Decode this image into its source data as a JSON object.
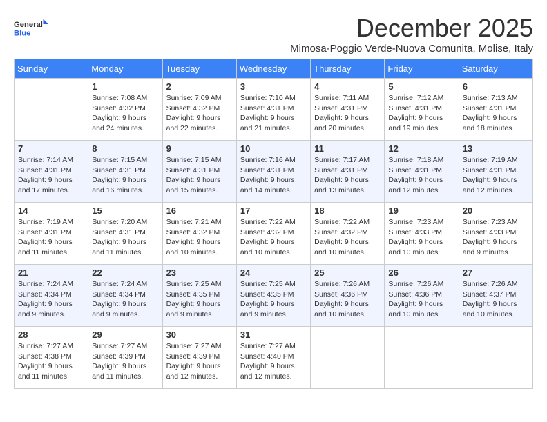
{
  "logo": {
    "general": "General",
    "blue": "Blue"
  },
  "title": "December 2025",
  "subtitle": "Mimosa-Poggio Verde-Nuova Comunita, Molise, Italy",
  "days_of_week": [
    "Sunday",
    "Monday",
    "Tuesday",
    "Wednesday",
    "Thursday",
    "Friday",
    "Saturday"
  ],
  "weeks": [
    [
      {
        "day": "",
        "info": ""
      },
      {
        "day": "1",
        "info": "Sunrise: 7:08 AM\nSunset: 4:32 PM\nDaylight: 9 hours\nand 24 minutes."
      },
      {
        "day": "2",
        "info": "Sunrise: 7:09 AM\nSunset: 4:32 PM\nDaylight: 9 hours\nand 22 minutes."
      },
      {
        "day": "3",
        "info": "Sunrise: 7:10 AM\nSunset: 4:31 PM\nDaylight: 9 hours\nand 21 minutes."
      },
      {
        "day": "4",
        "info": "Sunrise: 7:11 AM\nSunset: 4:31 PM\nDaylight: 9 hours\nand 20 minutes."
      },
      {
        "day": "5",
        "info": "Sunrise: 7:12 AM\nSunset: 4:31 PM\nDaylight: 9 hours\nand 19 minutes."
      },
      {
        "day": "6",
        "info": "Sunrise: 7:13 AM\nSunset: 4:31 PM\nDaylight: 9 hours\nand 18 minutes."
      }
    ],
    [
      {
        "day": "7",
        "info": "Sunrise: 7:14 AM\nSunset: 4:31 PM\nDaylight: 9 hours\nand 17 minutes."
      },
      {
        "day": "8",
        "info": "Sunrise: 7:15 AM\nSunset: 4:31 PM\nDaylight: 9 hours\nand 16 minutes."
      },
      {
        "day": "9",
        "info": "Sunrise: 7:15 AM\nSunset: 4:31 PM\nDaylight: 9 hours\nand 15 minutes."
      },
      {
        "day": "10",
        "info": "Sunrise: 7:16 AM\nSunset: 4:31 PM\nDaylight: 9 hours\nand 14 minutes."
      },
      {
        "day": "11",
        "info": "Sunrise: 7:17 AM\nSunset: 4:31 PM\nDaylight: 9 hours\nand 13 minutes."
      },
      {
        "day": "12",
        "info": "Sunrise: 7:18 AM\nSunset: 4:31 PM\nDaylight: 9 hours\nand 12 minutes."
      },
      {
        "day": "13",
        "info": "Sunrise: 7:19 AM\nSunset: 4:31 PM\nDaylight: 9 hours\nand 12 minutes."
      }
    ],
    [
      {
        "day": "14",
        "info": "Sunrise: 7:19 AM\nSunset: 4:31 PM\nDaylight: 9 hours\nand 11 minutes."
      },
      {
        "day": "15",
        "info": "Sunrise: 7:20 AM\nSunset: 4:31 PM\nDaylight: 9 hours\nand 11 minutes."
      },
      {
        "day": "16",
        "info": "Sunrise: 7:21 AM\nSunset: 4:32 PM\nDaylight: 9 hours\nand 10 minutes."
      },
      {
        "day": "17",
        "info": "Sunrise: 7:22 AM\nSunset: 4:32 PM\nDaylight: 9 hours\nand 10 minutes."
      },
      {
        "day": "18",
        "info": "Sunrise: 7:22 AM\nSunset: 4:32 PM\nDaylight: 9 hours\nand 10 minutes."
      },
      {
        "day": "19",
        "info": "Sunrise: 7:23 AM\nSunset: 4:33 PM\nDaylight: 9 hours\nand 10 minutes."
      },
      {
        "day": "20",
        "info": "Sunrise: 7:23 AM\nSunset: 4:33 PM\nDaylight: 9 hours\nand 9 minutes."
      }
    ],
    [
      {
        "day": "21",
        "info": "Sunrise: 7:24 AM\nSunset: 4:34 PM\nDaylight: 9 hours\nand 9 minutes."
      },
      {
        "day": "22",
        "info": "Sunrise: 7:24 AM\nSunset: 4:34 PM\nDaylight: 9 hours\nand 9 minutes."
      },
      {
        "day": "23",
        "info": "Sunrise: 7:25 AM\nSunset: 4:35 PM\nDaylight: 9 hours\nand 9 minutes."
      },
      {
        "day": "24",
        "info": "Sunrise: 7:25 AM\nSunset: 4:35 PM\nDaylight: 9 hours\nand 9 minutes."
      },
      {
        "day": "25",
        "info": "Sunrise: 7:26 AM\nSunset: 4:36 PM\nDaylight: 9 hours\nand 10 minutes."
      },
      {
        "day": "26",
        "info": "Sunrise: 7:26 AM\nSunset: 4:36 PM\nDaylight: 9 hours\nand 10 minutes."
      },
      {
        "day": "27",
        "info": "Sunrise: 7:26 AM\nSunset: 4:37 PM\nDaylight: 9 hours\nand 10 minutes."
      }
    ],
    [
      {
        "day": "28",
        "info": "Sunrise: 7:27 AM\nSunset: 4:38 PM\nDaylight: 9 hours\nand 11 minutes."
      },
      {
        "day": "29",
        "info": "Sunrise: 7:27 AM\nSunset: 4:39 PM\nDaylight: 9 hours\nand 11 minutes."
      },
      {
        "day": "30",
        "info": "Sunrise: 7:27 AM\nSunset: 4:39 PM\nDaylight: 9 hours\nand 12 minutes."
      },
      {
        "day": "31",
        "info": "Sunrise: 7:27 AM\nSunset: 4:40 PM\nDaylight: 9 hours\nand 12 minutes."
      },
      {
        "day": "",
        "info": ""
      },
      {
        "day": "",
        "info": ""
      },
      {
        "day": "",
        "info": ""
      }
    ]
  ]
}
